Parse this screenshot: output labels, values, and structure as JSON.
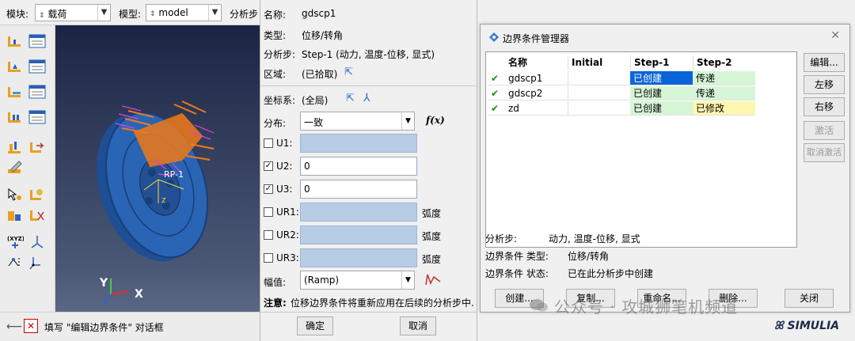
{
  "toolbar": {
    "module_label": "模块:",
    "module_value": "载荷",
    "model_label": "模型:",
    "model_value": "model",
    "step_label": "分析步"
  },
  "viewport": {
    "rp_label": "RP-1",
    "axis_y": "Y",
    "axis_x": "X",
    "axis_z": "Z"
  },
  "status": {
    "prompt": "填写 \"编辑边界条件\" 对话框"
  },
  "edit_dialog": {
    "name_label": "名称:",
    "name_value": "gdscp1",
    "type_label": "类型:",
    "type_value": "位移/转角",
    "step_label": "分析步:",
    "step_value": "Step-1 (动力, 温度-位移, 显式)",
    "region_label": "区域:",
    "region_value": "(已拾取)",
    "csys_label": "坐标系:",
    "csys_value": "(全局)",
    "dist_label": "分布:",
    "dist_value": "一致",
    "fx_label": "f(x)",
    "dofs": [
      {
        "label": "U1:",
        "checked": false,
        "value": "",
        "unit": ""
      },
      {
        "label": "U2:",
        "checked": true,
        "value": "0",
        "unit": ""
      },
      {
        "label": "U3:",
        "checked": true,
        "value": "0",
        "unit": ""
      },
      {
        "label": "UR1:",
        "checked": false,
        "value": "",
        "unit": "弧度"
      },
      {
        "label": "UR2:",
        "checked": false,
        "value": "",
        "unit": "弧度"
      },
      {
        "label": "UR3:",
        "checked": false,
        "value": "",
        "unit": "弧度"
      }
    ],
    "amp_label": "幅值:",
    "amp_value": "(Ramp)",
    "note_label": "注意:",
    "note_text": "位移边界条件将重新应用在后续的分析步中.",
    "ok_label": "确定",
    "cancel_label": "取消"
  },
  "manager": {
    "title": "边界条件管理器",
    "columns": [
      "名称",
      "Initial",
      "Step-1",
      "Step-2"
    ],
    "rows": [
      {
        "check": "✔",
        "name": "gdscp1",
        "initial": "",
        "step1": "已创建",
        "step2": "传递"
      },
      {
        "check": "✔",
        "name": "gdscp2",
        "initial": "",
        "step1": "已创建",
        "step2": "传递"
      },
      {
        "check": "✔",
        "name": "zd",
        "initial": "",
        "step1": "已创建",
        "step2": "已修改"
      }
    ],
    "side_buttons": [
      "编辑...",
      "左移",
      "右移",
      "激活",
      "取消激活"
    ],
    "info_step_label": "分析步:",
    "info_step_value": "动力, 温度-位移, 显式",
    "info_type_label": "边界条件 类型:",
    "info_type_value": "位移/转角",
    "info_state_label": "边界条件 状态:",
    "info_state_value": "已在此分析步中创建",
    "bottom_buttons": [
      "创建...",
      "复制...",
      "重命名...",
      "删除...",
      "关闭"
    ]
  },
  "watermark": "公众号 · 攻城狮笔机频道",
  "brand": "SIMULIA",
  "colors": {
    "selected_cell": "#0a64d8",
    "created_cell": "#d6f5d6",
    "modified_cell": "#fff6b0",
    "field_disabled": "#b7cde6",
    "disc_blue": "#2a64b4",
    "load_orange": "#f07a18"
  }
}
